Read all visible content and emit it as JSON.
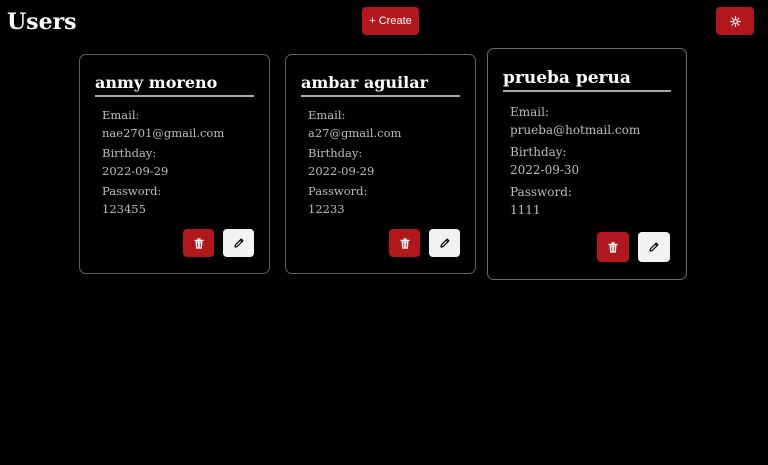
{
  "header": {
    "title": "Users",
    "create_label": "+ Create"
  },
  "labels": {
    "email": "Email:",
    "birthday": "Birthday:",
    "password": "Password:"
  },
  "users": [
    {
      "name": "anmy moreno",
      "email": "nae2701@gmail.com",
      "birthday": "2022-09-29",
      "password": "123455"
    },
    {
      "name": "ambar aguilar",
      "email": "a27@gmail.com",
      "birthday": "2022-09-29",
      "password": "12233"
    },
    {
      "name": "prueba perua",
      "email": "prueba@hotmail.com",
      "birthday": "2022-09-30",
      "password": "1111"
    }
  ],
  "icons": {
    "settings": "gear-icon",
    "delete": "trash-icon",
    "edit": "pencil-icon"
  },
  "colors": {
    "background": "#000000",
    "accent": "#b0181d",
    "edit_button": "#f2f2f2",
    "card_border": "#5f5f5f",
    "text": "#ffffff",
    "muted_text": "#bdbdbd"
  }
}
